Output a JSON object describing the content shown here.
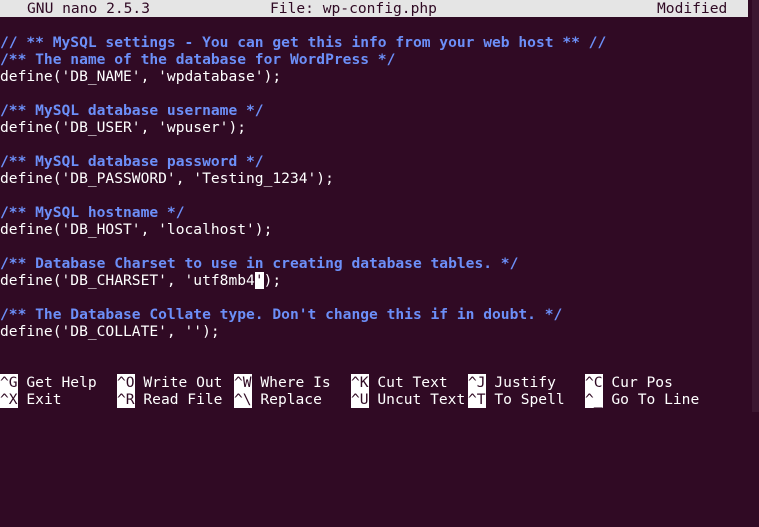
{
  "titlebar": {
    "app": "GNU nano 2.5.3",
    "file": "File: wp-config.php",
    "status": "Modified"
  },
  "editor": {
    "line_01": "// ** MySQL settings - You can get this info from your web host ** //",
    "line_02": "/** The name of the database for WordPress */",
    "line_03": "define('DB_NAME', 'wpdatabase');",
    "line_05": "/** MySQL database username */",
    "line_06": "define('DB_USER', 'wpuser');",
    "line_08": "/** MySQL database password */",
    "line_09": "define('DB_PASSWORD', 'Testing_1234');",
    "line_11": "/** MySQL hostname */",
    "line_12": "define('DB_HOST', 'localhost');",
    "line_14": "/** Database Charset to use in creating database tables. */",
    "line_15_before": "define('DB_CHARSET', 'utf8mb4",
    "line_15_cursor": "'",
    "line_15_after": ");",
    "line_17": "/** The Database Collate type. Don't change this if in doubt. */",
    "line_18": "define('DB_COLLATE', '');"
  },
  "shortcuts": {
    "row1": [
      {
        "key": "^G",
        "label": "Get Help"
      },
      {
        "key": "^O",
        "label": "Write Out"
      },
      {
        "key": "^W",
        "label": "Where Is"
      },
      {
        "key": "^K",
        "label": "Cut Text"
      },
      {
        "key": "^J",
        "label": "Justify"
      },
      {
        "key": "^C",
        "label": "Cur Pos"
      }
    ],
    "row2": [
      {
        "key": "^X",
        "label": "Exit"
      },
      {
        "key": "^R",
        "label": "Read File"
      },
      {
        "key": "^\\",
        "label": "Replace"
      },
      {
        "key": "^U",
        "label": "Uncut Text"
      },
      {
        "key": "^T",
        "label": "To Spell"
      },
      {
        "key": "^_",
        "label": "Go To Line"
      }
    ]
  }
}
